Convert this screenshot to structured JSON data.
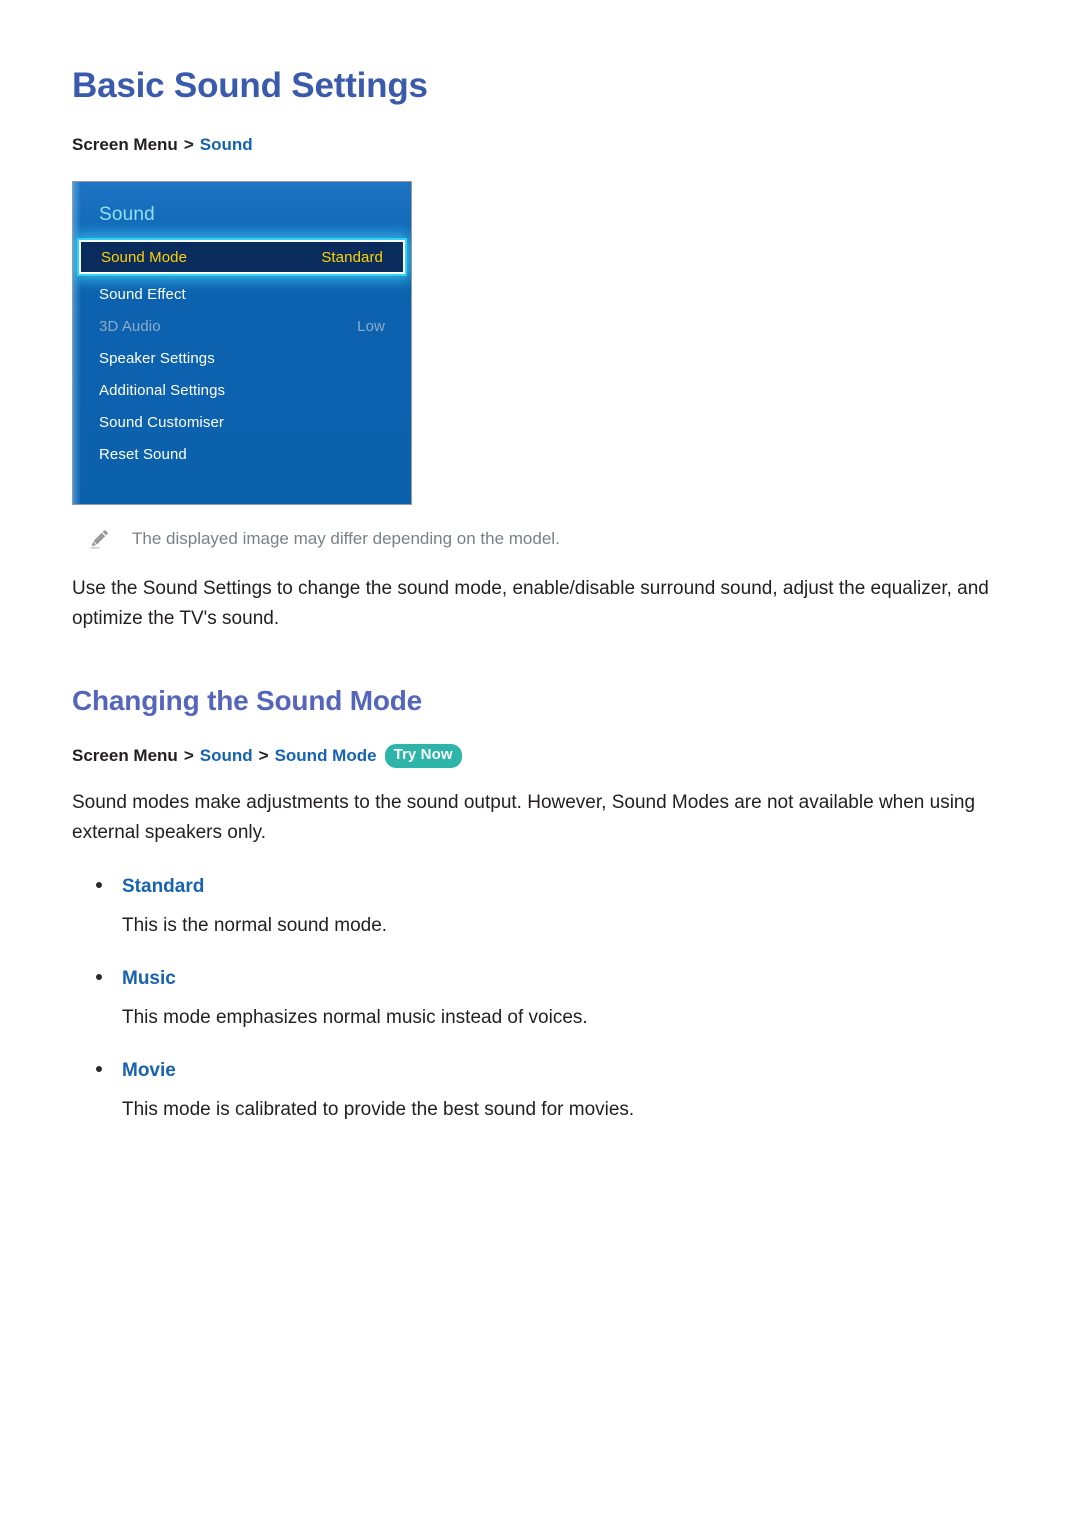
{
  "page": {
    "title": "Basic Sound Settings"
  },
  "breadcrumb_top": {
    "prefix": "Screen Menu",
    "separator": ">",
    "link": "Sound"
  },
  "tv_menu": {
    "header": "Sound",
    "rows": [
      {
        "label": "Sound Mode",
        "value": "Standard",
        "state": "selected"
      },
      {
        "label": "Sound Effect",
        "value": "",
        "state": "normal"
      },
      {
        "label": "3D Audio",
        "value": "Low",
        "state": "disabled"
      },
      {
        "label": "Speaker Settings",
        "value": "",
        "state": "normal"
      },
      {
        "label": "Additional Settings",
        "value": "",
        "state": "normal"
      },
      {
        "label": "Sound Customiser",
        "value": "",
        "state": "normal"
      },
      {
        "label": "Reset Sound",
        "value": "",
        "state": "normal"
      }
    ],
    "colors": {
      "panel_blue": "#0c61ad",
      "header_text": "#8fe0f5",
      "selected_bg": "#0a2c5c",
      "selected_text": "#ffd200",
      "glow": "#2fd3f5",
      "disabled_text": "#8fabc9"
    }
  },
  "note": {
    "icon": "pencil-icon",
    "text": "The displayed image may differ depending on the model."
  },
  "intro_paragraph": "Use the Sound Settings to change the sound mode, enable/disable surround sound, adjust the equalizer, and optimize the TV's sound.",
  "section": {
    "title": "Changing the Sound Mode",
    "breadcrumb": {
      "prefix": "Screen Menu",
      "separator": ">",
      "link1": "Sound",
      "link2": "Sound Mode",
      "badge": "Try Now"
    },
    "paragraph": "Sound modes make adjustments to the sound output. However, Sound Modes are not available when using external speakers only.",
    "modes": [
      {
        "name": "Standard",
        "description": "This is the normal sound mode."
      },
      {
        "name": "Music",
        "description": "This mode emphasizes normal music instead of voices."
      },
      {
        "name": "Movie",
        "description": "This mode is calibrated to provide the best sound for movies."
      }
    ]
  },
  "colors": {
    "h1": "#3a5aab",
    "h2": "#5466bb",
    "link": "#1763b0",
    "badge": "#2cb5a8",
    "body_text": "#231f20",
    "note_text": "#7b7f88"
  }
}
